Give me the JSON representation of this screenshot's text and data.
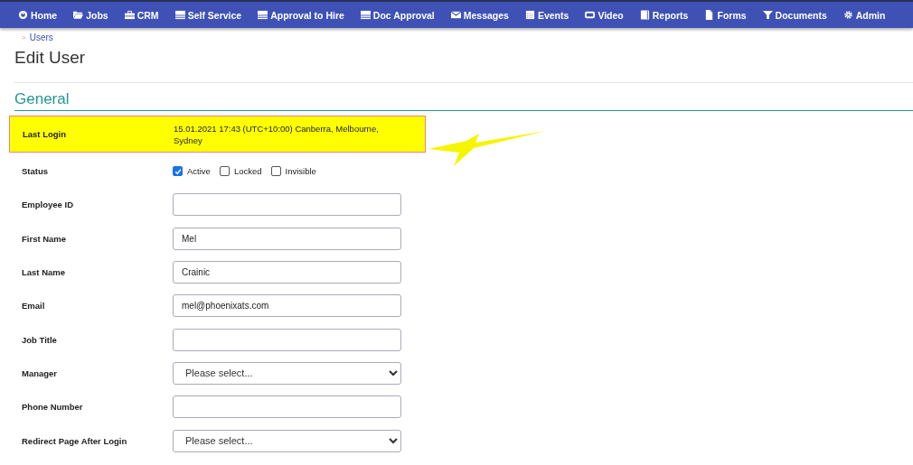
{
  "nav": [
    {
      "label": "Home"
    },
    {
      "label": "Jobs"
    },
    {
      "label": "CRM"
    },
    {
      "label": "Self Service"
    },
    {
      "label": "Approval to Hire"
    },
    {
      "label": "Doc Approval"
    },
    {
      "label": "Messages"
    },
    {
      "label": "Events"
    },
    {
      "label": "Video"
    },
    {
      "label": "Reports"
    },
    {
      "label": "Forms"
    },
    {
      "label": "Documents"
    },
    {
      "label": "Admin"
    }
  ],
  "breadcrumb": {
    "separator": ">",
    "link": "Users"
  },
  "title": "Edit User",
  "section": "General",
  "fields": [
    {
      "kind": "static",
      "label": "Last Login",
      "value": "15.01.2021 17:43 (UTC+10:00) Canberra, Melbourne, Sydney",
      "highlighted": true
    },
    {
      "kind": "checks",
      "label": "Status",
      "options": [
        {
          "label": "Active",
          "checked": true
        },
        {
          "label": "Locked",
          "checked": false
        },
        {
          "label": "Invisible",
          "checked": false
        }
      ]
    },
    {
      "kind": "text",
      "label": "Employee ID"
    },
    {
      "kind": "text",
      "label": "First Name",
      "value": "Mel"
    },
    {
      "kind": "text",
      "label": "Last Name",
      "value": "Crainic"
    },
    {
      "kind": "text",
      "label": "Email",
      "value": "mel@phoenixats.com"
    },
    {
      "kind": "text",
      "label": "Job Title"
    },
    {
      "kind": "select",
      "label": "Manager",
      "value": "Please select..."
    },
    {
      "kind": "text",
      "label": "Phone Number"
    },
    {
      "kind": "select",
      "label": "Redirect Page After Login",
      "value": "Please select..."
    }
  ]
}
